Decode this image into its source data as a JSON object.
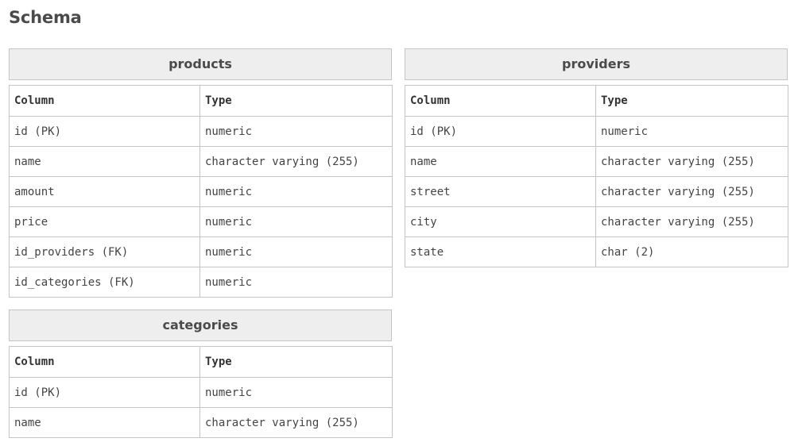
{
  "page": {
    "title": "Schema"
  },
  "headers": {
    "column": "Column",
    "type": "Type"
  },
  "tables": {
    "products": {
      "name": "products",
      "rows": [
        {
          "column": "id (PK)",
          "type": "numeric"
        },
        {
          "column": "name",
          "type": "character varying (255)"
        },
        {
          "column": "amount",
          "type": "numeric"
        },
        {
          "column": "price",
          "type": "numeric"
        },
        {
          "column": "id_providers (FK)",
          "type": "numeric"
        },
        {
          "column": "id_categories (FK)",
          "type": "numeric"
        }
      ]
    },
    "providers": {
      "name": "providers",
      "rows": [
        {
          "column": "id (PK)",
          "type": "numeric"
        },
        {
          "column": "name",
          "type": "character varying (255)"
        },
        {
          "column": "street",
          "type": "character varying (255)"
        },
        {
          "column": "city",
          "type": "character varying (255)"
        },
        {
          "column": "state",
          "type": "char (2)"
        }
      ]
    },
    "categories": {
      "name": "categories",
      "rows": [
        {
          "column": "id (PK)",
          "type": "numeric"
        },
        {
          "column": "name",
          "type": "character varying (255)"
        }
      ]
    }
  }
}
